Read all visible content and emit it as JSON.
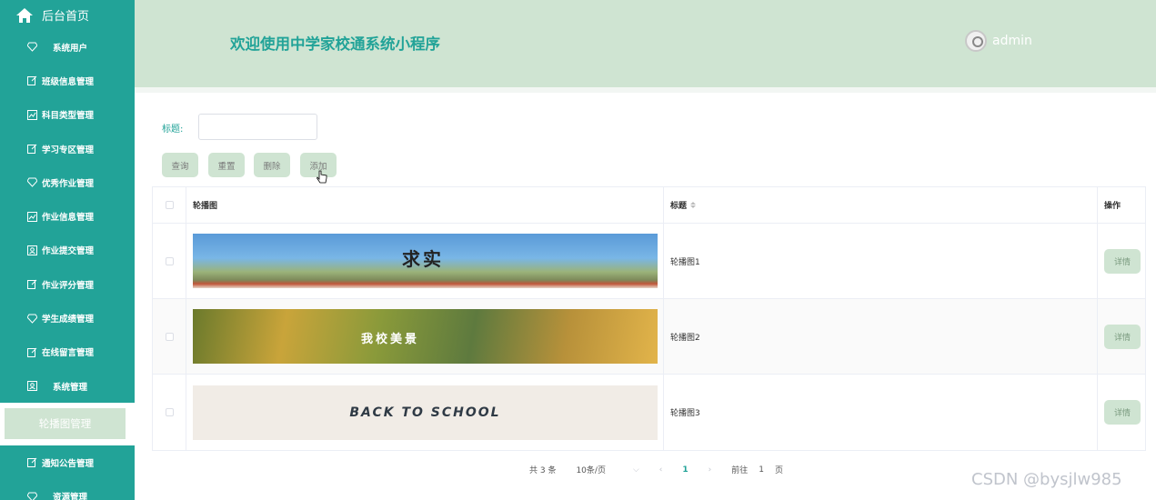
{
  "sidebar": {
    "home_label": "后台首页",
    "items": [
      {
        "label": "系统用户",
        "icon": "diamond-icon",
        "centered": true
      },
      {
        "label": "班级信息管理",
        "icon": "edit-icon"
      },
      {
        "label": "科目类型管理",
        "icon": "chart-icon"
      },
      {
        "label": "学习专区管理",
        "icon": "edit-icon"
      },
      {
        "label": "优秀作业管理",
        "icon": "diamond-icon"
      },
      {
        "label": "作业信息管理",
        "icon": "chart-icon"
      },
      {
        "label": "作业提交管理",
        "icon": "user-box-icon"
      },
      {
        "label": "作业评分管理",
        "icon": "edit-icon"
      },
      {
        "label": "学生成绩管理",
        "icon": "diamond-icon"
      },
      {
        "label": "在线留言管理",
        "icon": "edit-icon"
      },
      {
        "label": "系统管理",
        "icon": "user-box-icon",
        "centered": true
      }
    ],
    "active_submenu": "轮播图管理",
    "after_items": [
      {
        "label": "通知公告管理",
        "icon": "edit-icon"
      },
      {
        "label": "资源管理",
        "icon": "diamond-icon",
        "centered": true
      }
    ]
  },
  "header": {
    "title": "欢迎使用中学家校通系统小程序",
    "username": "admin"
  },
  "search": {
    "label": "标题:",
    "value": "",
    "placeholder": ""
  },
  "buttons": {
    "query": "查询",
    "reset": "重置",
    "delete": "删除",
    "add": "添加"
  },
  "table": {
    "columns": {
      "image": "轮播图",
      "title": "标题",
      "action": "操作"
    },
    "rows": [
      {
        "title": "轮播图1",
        "image_text": "求实",
        "action": "详情"
      },
      {
        "title": "轮播图2",
        "image_text": "我校美景",
        "action": "详情"
      },
      {
        "title": "轮播图3",
        "image_text": "BACK TO SCHOOL",
        "action": "详情"
      }
    ]
  },
  "pagination": {
    "total": "共 3 条",
    "page_size": "10条/页",
    "current_page": "1",
    "goto_label": "前往",
    "goto_value": "1",
    "page_suffix": "页"
  },
  "watermark": "CSDN @bysjlw985",
  "colors": {
    "sidebar": "#22a398",
    "header": "#cfe4d2",
    "accent": "#22a398",
    "button": "#cfe4d2"
  }
}
